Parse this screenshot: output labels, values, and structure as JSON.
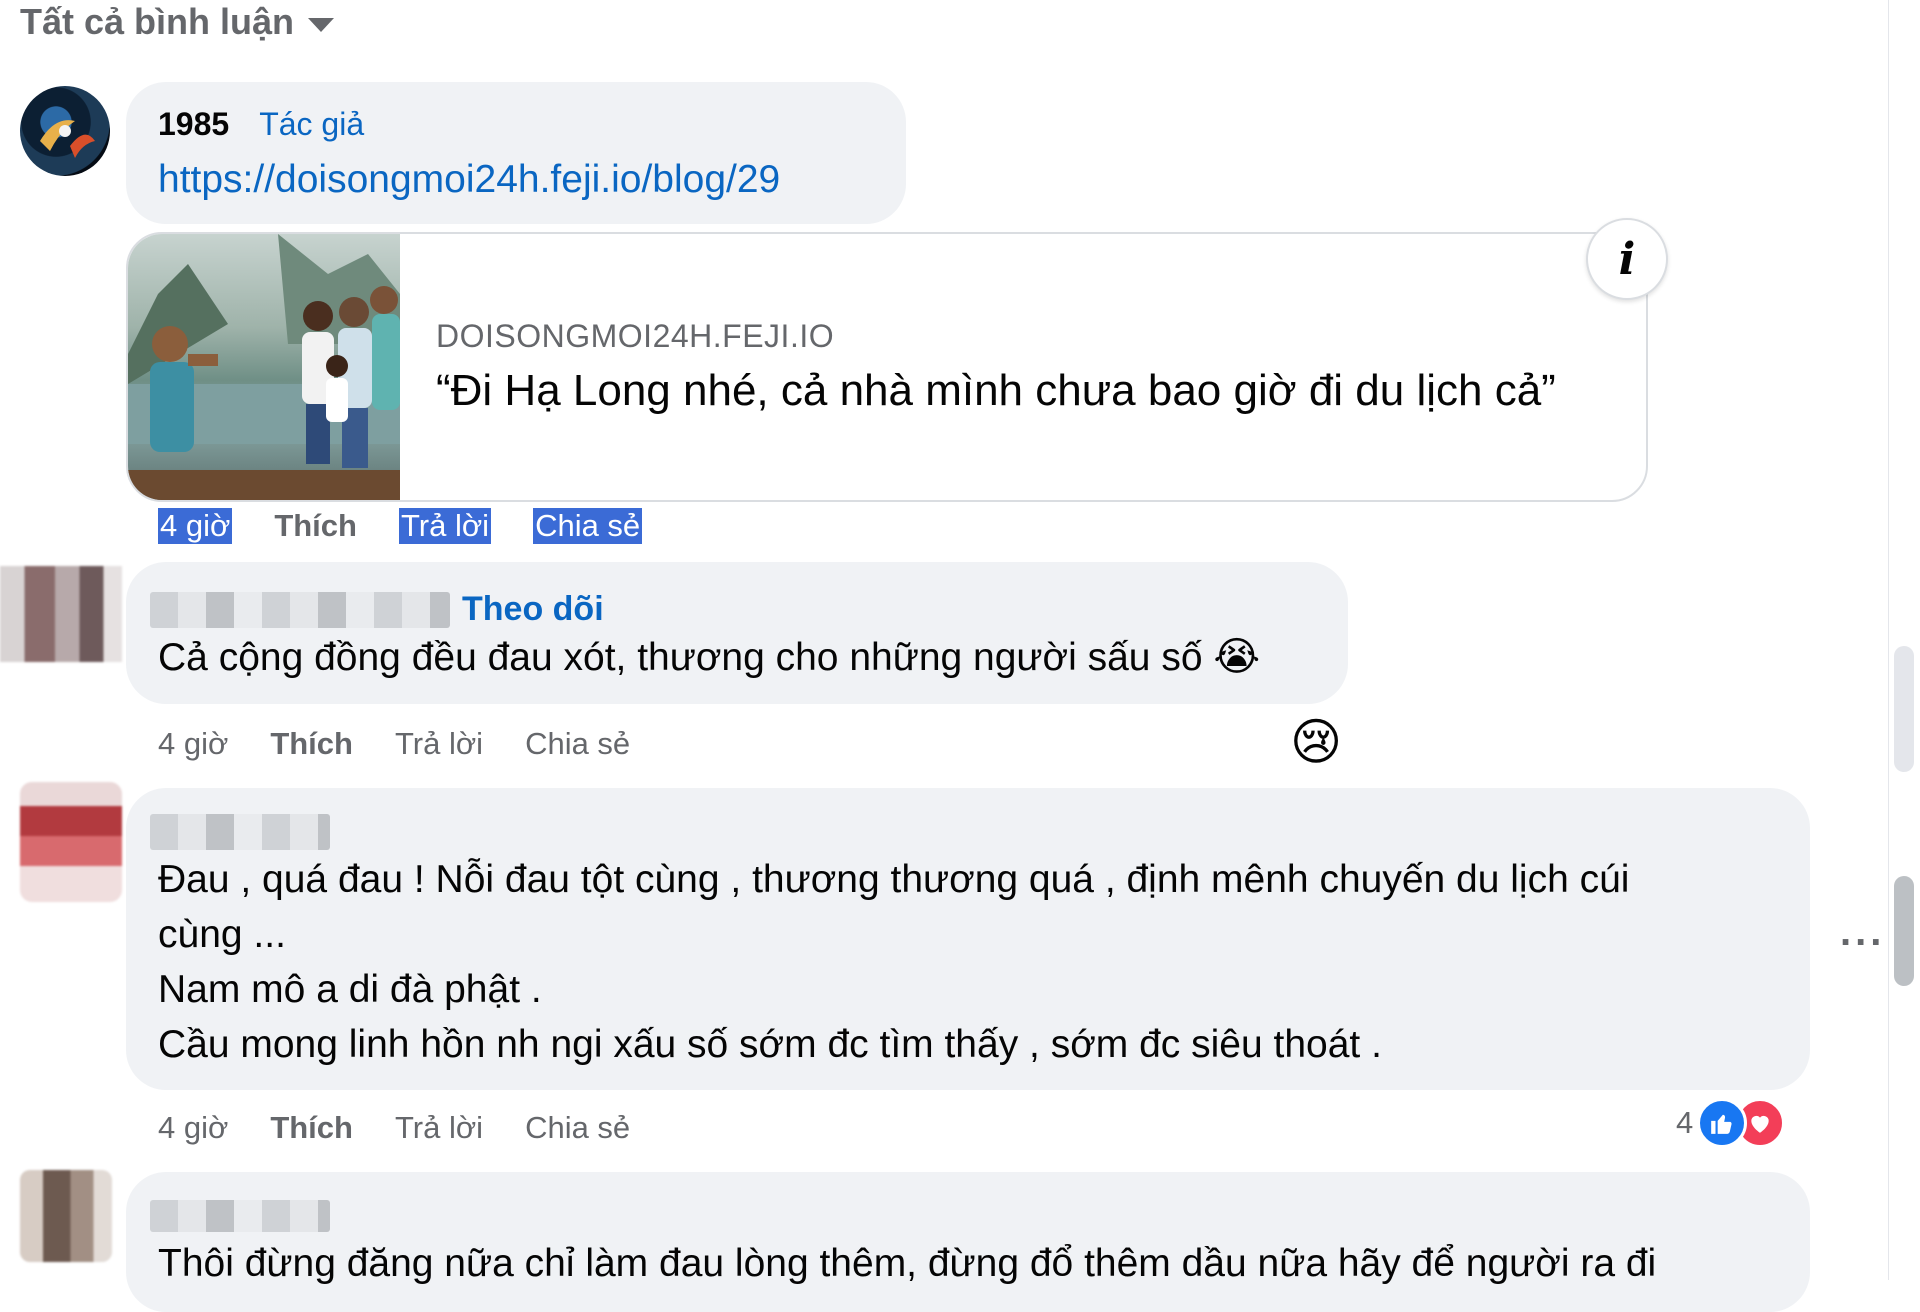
{
  "filter": {
    "label": "Tất cả bình luận"
  },
  "comments": [
    {
      "author": "1985",
      "author_tag": "Tác giả",
      "link_text": "https://doisongmoi24h.feji.io/blog/29",
      "preview": {
        "domain": "DOISONGMOI24H.FEJI.IO",
        "title": "“Đi Hạ Long nhé, cả nhà mình chưa bao giờ đi du lịch cả”"
      },
      "actions": {
        "time": "4 giờ",
        "like": "Thích",
        "reply": "Trả lời",
        "share": "Chia sẻ"
      }
    },
    {
      "follow": "Theo dõi",
      "text": "Cả cộng đồng đều đau xót, thương cho những người sấu số",
      "emoji": "😭",
      "reaction": "😢",
      "actions": {
        "time": "4 giờ",
        "like": "Thích",
        "reply": "Trả lời",
        "share": "Chia sẻ"
      }
    },
    {
      "lines": [
        "Đau , quá đau ! Nỗi đau tột cùng , thương thương quá , định mênh chuyến du lịch cúi",
        "cùng ...",
        "Nam mô a di đà phật .",
        "Cầu mong linh hồn nh ngi xấu số sớm đc tìm thấy , sớm đc siêu thoát ."
      ],
      "reaction_count": "4",
      "more": "...",
      "actions": {
        "time": "4 giờ",
        "like": "Thích",
        "reply": "Trả lời",
        "share": "Chia sẻ"
      }
    },
    {
      "text": "Thôi đừng đăng nữa chỉ làm đau lòng thêm, đừng đổ thêm dầu nữa hãy để người ra đi"
    }
  ],
  "colors": {
    "link": "#0a66c2",
    "bubble": "#f0f2f5",
    "secondary_text": "#65676b"
  }
}
